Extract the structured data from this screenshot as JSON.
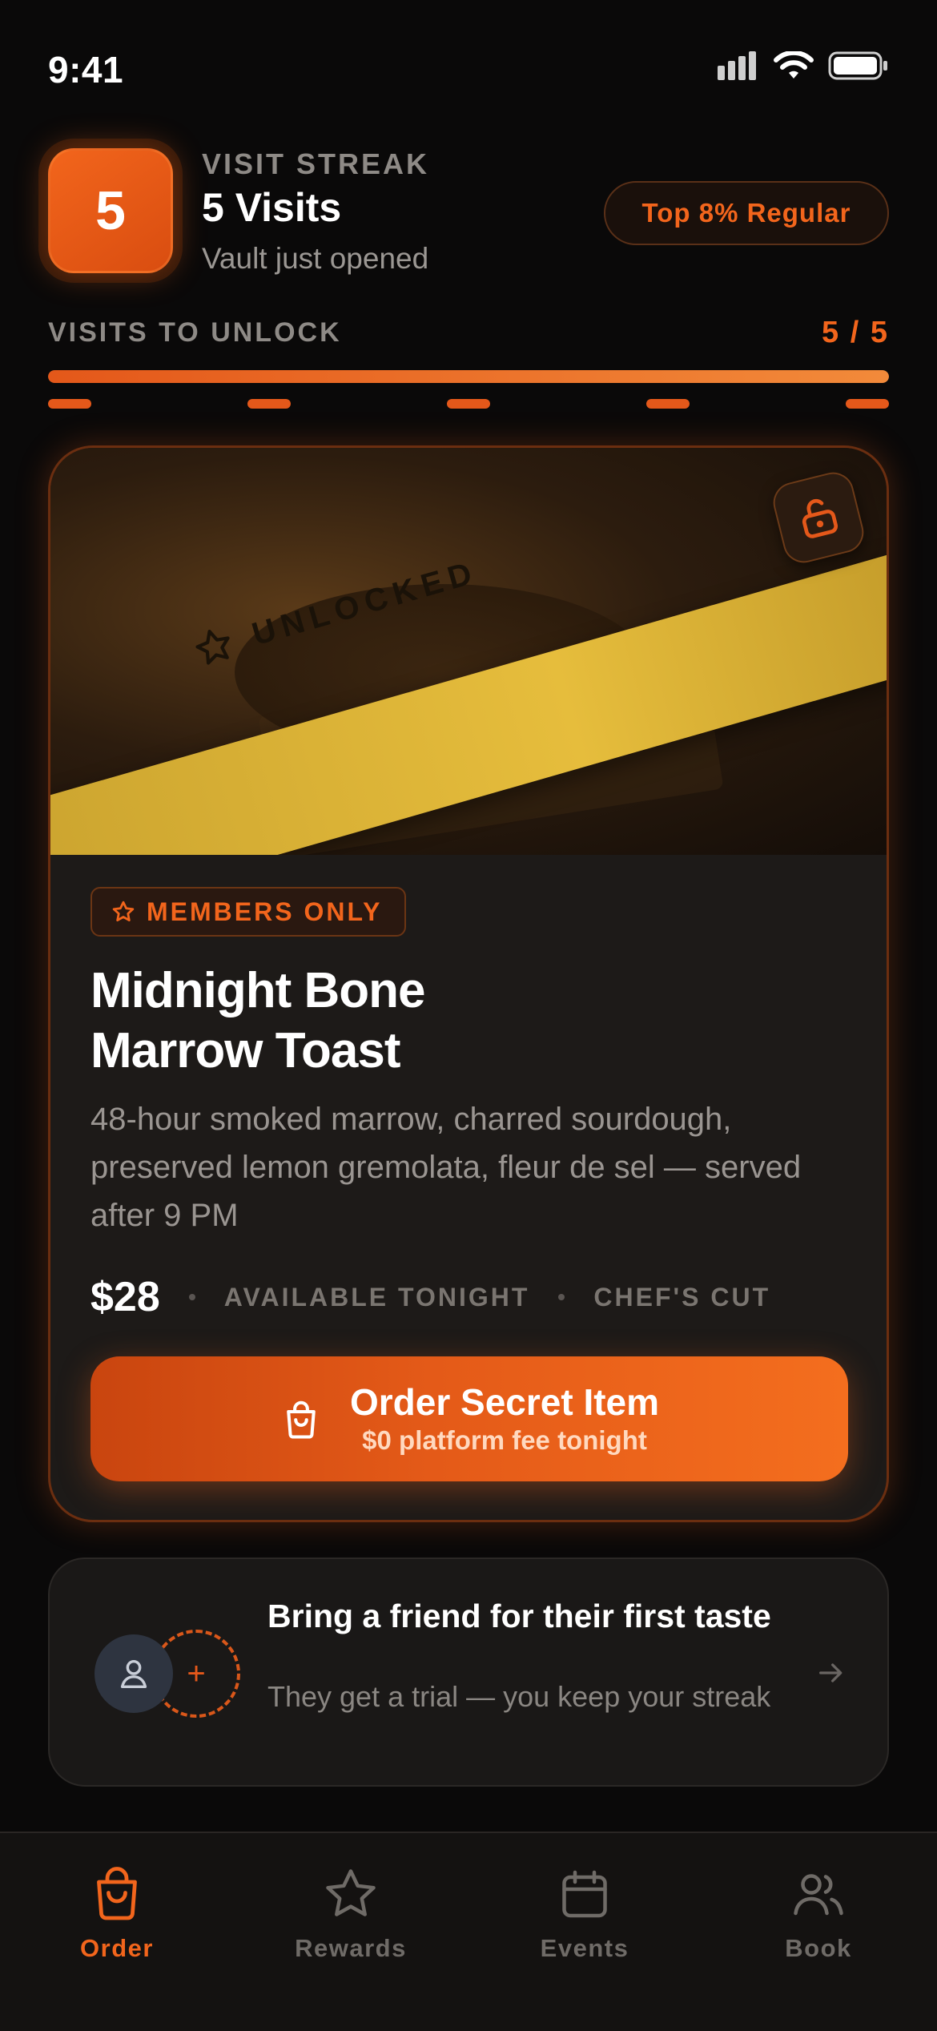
{
  "status_bar": {
    "time": "9:41"
  },
  "streak": {
    "count": "5",
    "eyebrow": "VISIT STREAK",
    "title": "5 Visits",
    "subtitle": "Vault just opened",
    "rank": "Top 8% Regular"
  },
  "progress": {
    "label": "VISITS TO UNLOCK",
    "count_text": "5 / 5",
    "fraction": 1.0,
    "ticks": 5
  },
  "card": {
    "ribbon": "UNLOCKED",
    "badge": "MEMBERS ONLY",
    "title_line1": "Midnight Bone",
    "title_line2": "Marrow Toast",
    "description": "48-hour smoked marrow, charred sourdough, preserved lemon gremolata, fleur de sel — served after 9 PM",
    "price": "$28",
    "tag1": "AVAILABLE TONIGHT",
    "tag2": "CHEF'S CUT",
    "button_main": "Order Secret Item",
    "button_sub": "$0 platform fee tonight"
  },
  "friend": {
    "title": "Bring a friend for their first taste",
    "subtitle": "They get a trial — you keep your streak",
    "icon_add": "+"
  },
  "tabs": [
    {
      "label": "Order",
      "icon": "bag-icon",
      "active": true
    },
    {
      "label": "Rewards",
      "icon": "star-icon",
      "active": false
    },
    {
      "label": "Events",
      "icon": "calendar-icon",
      "active": false
    },
    {
      "label": "Book",
      "icon": "users-icon",
      "active": false
    }
  ],
  "colors": {
    "accent": "#f2651c",
    "ribbon": "#e6bd3c",
    "background": "#0a0909"
  }
}
